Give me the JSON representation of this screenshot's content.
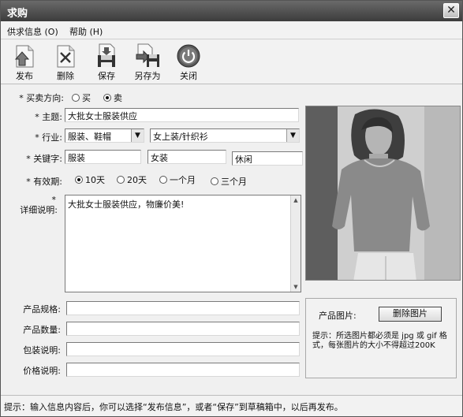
{
  "window": {
    "title": "求购",
    "close_glyph": "✕"
  },
  "menu": [
    "供求信息 (O)",
    "帮助 (H)"
  ],
  "toolbar": [
    {
      "label": "发布",
      "icon": "publish-icon"
    },
    {
      "label": "删除",
      "icon": "delete-icon"
    },
    {
      "label": "保存",
      "icon": "save-icon"
    },
    {
      "label": "另存为",
      "icon": "save-as-icon"
    },
    {
      "label": "关闭",
      "icon": "power-icon"
    }
  ],
  "form": {
    "direction": {
      "label": "* 买卖方向:",
      "options": [
        "买",
        "卖"
      ],
      "selected": "卖"
    },
    "subject": {
      "label": "* 主题:",
      "value": "大批女士服装供应"
    },
    "industry": {
      "label": "* 行业:",
      "value1": "服装、鞋帽",
      "value2": "女上装/针织衫"
    },
    "keywords": {
      "label": "* 关键字:",
      "values": [
        "服装",
        "女装",
        "休闲"
      ]
    },
    "validity": {
      "label": "* 有效期:",
      "options": [
        "10天",
        "20天",
        "一个月",
        "三个月"
      ],
      "selected": "10天"
    },
    "details": {
      "label_star": "*",
      "label": "详细说明:",
      "value": "大批女士服装供应，物廉价美!"
    },
    "spec": {
      "label": "产品规格:",
      "value": ""
    },
    "quantity": {
      "label": "产品数量:",
      "value": ""
    },
    "packaging": {
      "label": "包装说明:",
      "value": ""
    },
    "price": {
      "label": "价格说明:",
      "value": ""
    }
  },
  "image_panel": {
    "label": "产品图片:",
    "delete_button": "删除图片",
    "hint": "提示：所选图片都必须是 jpg 或 gif 格式，每张图片的大小不得超过200K"
  },
  "status": "提示：输入信息内容后，你可以选择“发布信息”，或者“保存”到草稿箱中，以后再发布。"
}
